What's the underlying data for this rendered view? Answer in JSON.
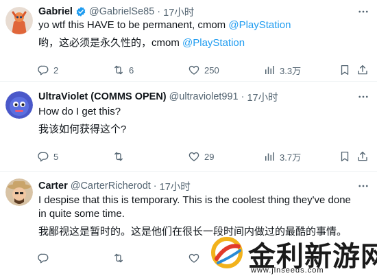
{
  "tweets": [
    {
      "name": "Gabriel",
      "handle": "@GabrielSe85",
      "dot": "·",
      "time": "17小时",
      "line1_text": "yo wtf this HAVE to be permanent, cmom ",
      "line1_mention": "@PlayStation",
      "line2_text": "哟，这必须是永久性的，cmom ",
      "line2_mention": "@PlayStation",
      "replies": "2",
      "retweets": "6",
      "likes": "250",
      "views": "3.3万"
    },
    {
      "name": "UltraViolet (COMMS OPEN)",
      "handle": "@ultraviolet991",
      "dot": "·",
      "time": "17小时",
      "line1_text": "How do I get this?",
      "line2_text": "我该如何获得这个?",
      "replies": "5",
      "retweets": "",
      "likes": "29",
      "views": "3.7万"
    },
    {
      "name": "Carter",
      "handle": "@CarterRicherodt",
      "dot": "·",
      "time": "17小时",
      "line1_text": "I despise that this is temporary. This is the coolest thing they've done in quite some time.",
      "line2_text": "我鄙视这是暂时的。这是他们在很长一段时间内做过的最酷的事情。",
      "replies": "",
      "retweets": "",
      "likes": "",
      "views": ""
    }
  ],
  "watermark": {
    "title": "金利新游网",
    "url": "www.jlnseeds.com"
  },
  "colors": {
    "text": "#0f1419",
    "secondary": "#536471",
    "mention": "#1d9bf0",
    "verified": "#1d9bf0",
    "divider": "#eff3f4"
  },
  "icons": [
    "verified-badge-icon",
    "more-icon",
    "reply-icon",
    "retweet-icon",
    "like-icon",
    "views-icon",
    "bookmark-icon",
    "share-icon"
  ]
}
